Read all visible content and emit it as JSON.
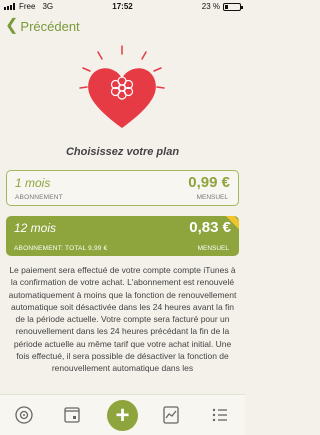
{
  "status": {
    "carrier": "Free",
    "network": "3G",
    "time": "17:52",
    "battery_text": "23 %",
    "battery_level": 0.23
  },
  "nav": {
    "back_label": "Précédent"
  },
  "header": {
    "title": "Choisissez votre plan"
  },
  "plans": [
    {
      "title": "1 mois",
      "subtitle": "ABONNEMENT",
      "price": "0,99 €",
      "unit": "MENSUEL"
    },
    {
      "title": "12 mois",
      "subtitle": "ABONNEMENT: TOTAL 9,99 €",
      "price": "0,83 €",
      "unit": "MENSUEL"
    }
  ],
  "legal_text": "Le paiement sera effectué de votre compte compte iTunes à la confirmation de votre achat. L'abonnement est renouvelé automatiquement à moins que la fonction de renouvellement automatique soit désactivée dans les 24 heures avant la fin de la période actuelle. Votre compte sera facturé pour un renouvellement dans les 24 heures précédant la fin de la période actuelle au même tarif que votre achat initial. Une fois effectué, il sera possible de désactiver la fonction de renouvellement automatique dans les",
  "tabbar": {
    "add_label": "+"
  },
  "colors": {
    "accent": "#8ea43c",
    "heart": "#e63a45",
    "background": "#f3f1ea",
    "ribbon": "#f0c62c"
  }
}
